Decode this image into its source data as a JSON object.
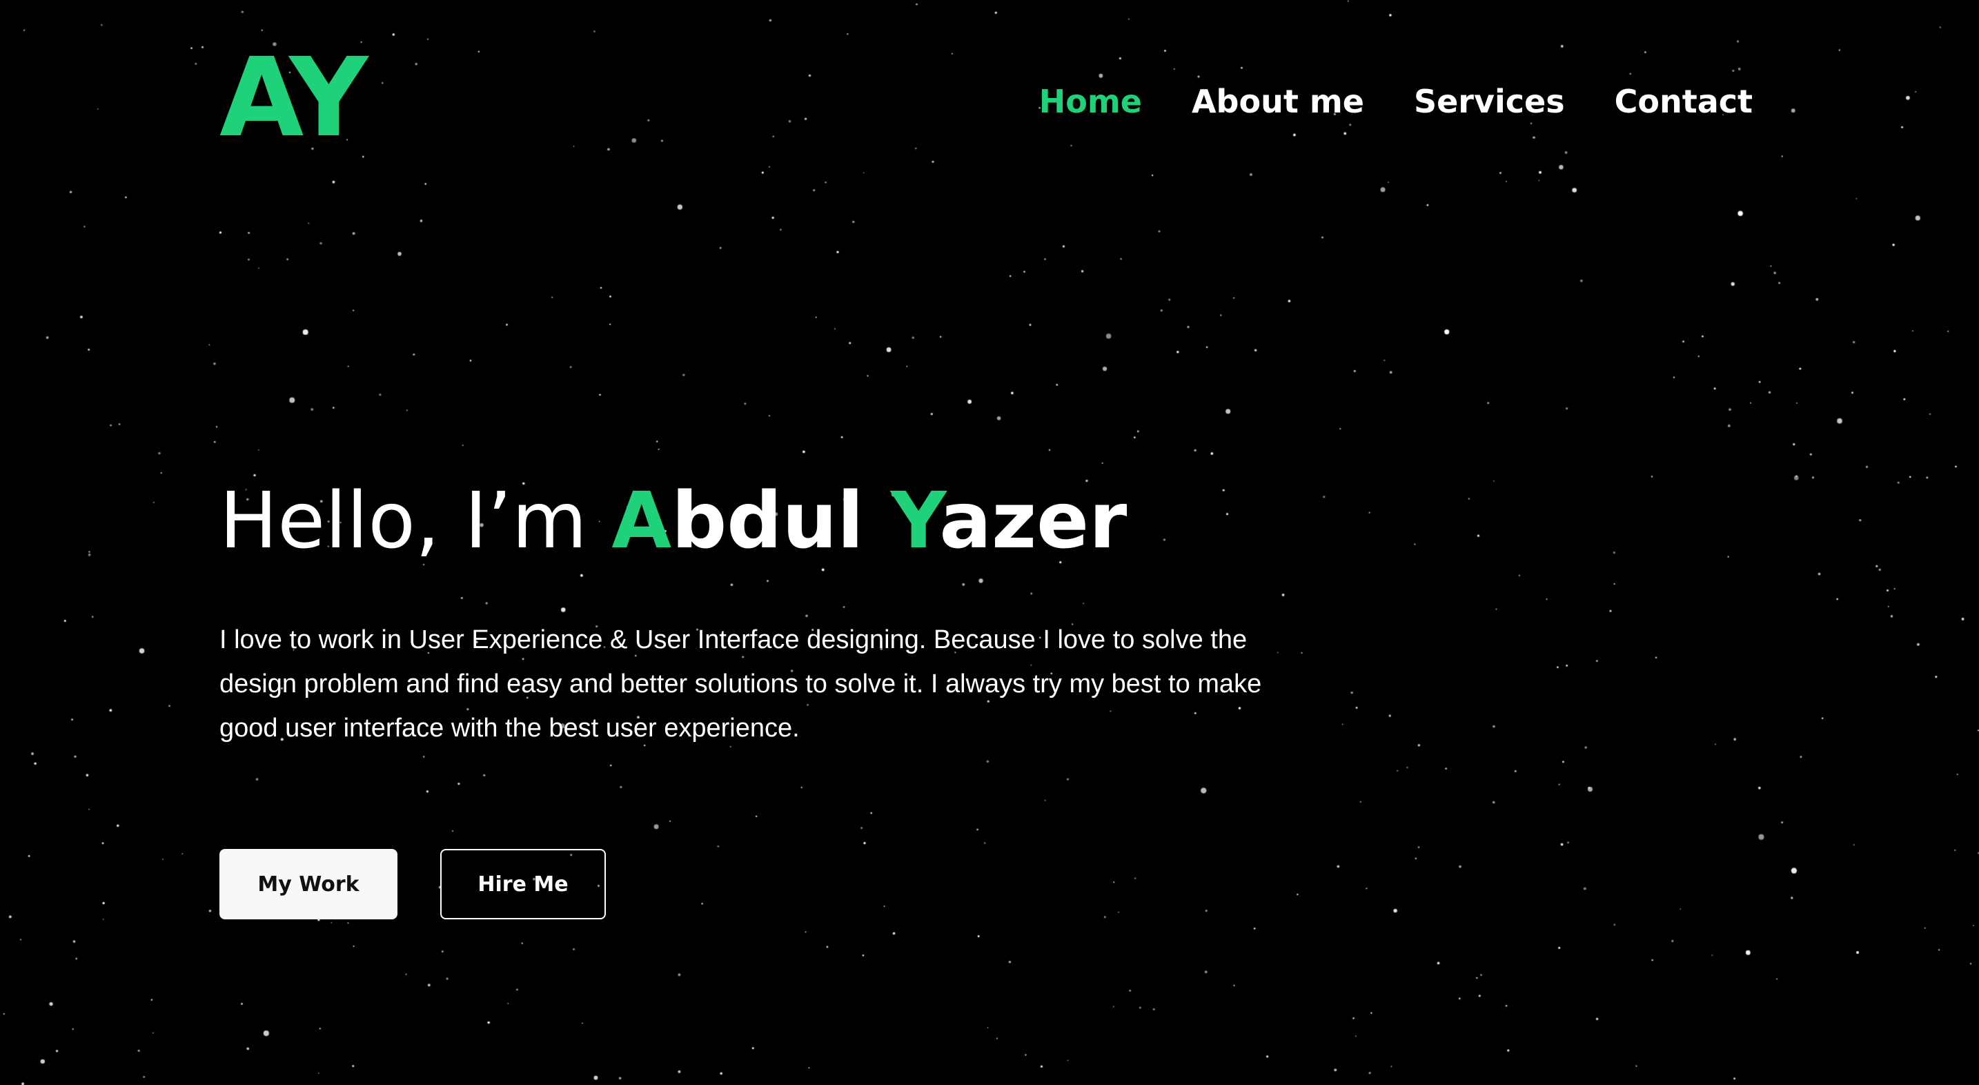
{
  "colors": {
    "background": "#000000",
    "accent": "#1fd27a",
    "text": "#ffffff"
  },
  "logo": {
    "text": "AY"
  },
  "nav": {
    "items": [
      {
        "label": "Home",
        "active": true
      },
      {
        "label": "About me",
        "active": false
      },
      {
        "label": "Services",
        "active": false
      },
      {
        "label": "Contact",
        "active": false
      }
    ]
  },
  "hero": {
    "greeting": "Hello, I’m ",
    "first_initial": "A",
    "first_rest": "bdul ",
    "last_initial": "Y",
    "last_rest": "azer",
    "description": "I love to work in User Experience & User Interface designing. Because I love to solve the design problem and find easy and better solutions to solve it. I always try my best to make good user interface with the best user experience."
  },
  "buttons": {
    "my_work": "My Work",
    "hire_me": "Hire Me"
  }
}
